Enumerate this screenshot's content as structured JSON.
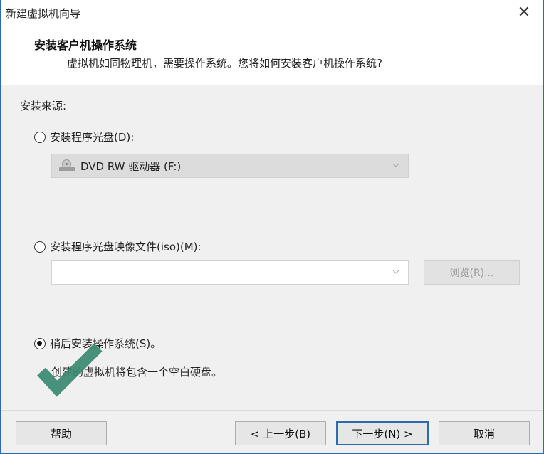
{
  "window": {
    "title": "新建虚拟机向导",
    "close_glyph": "✕"
  },
  "header": {
    "title": "安装客户机操作系统",
    "subtitle": "虚拟机如同物理机，需要操作系统。您将如何安装客户机操作系统?"
  },
  "source_label": "安装来源:",
  "options": {
    "disc": {
      "label": "安装程序光盘(D):",
      "selected": false
    },
    "disc_drive": {
      "value": "DVD RW 驱动器 (F:)",
      "icon": "dvd-drive-icon",
      "enabled": false
    },
    "iso": {
      "label": "安装程序光盘映像文件(iso)(M):",
      "selected": false
    },
    "iso_path": {
      "value": "",
      "placeholder": ""
    },
    "browse_label": "浏览(R)...",
    "later": {
      "label": "稍后安装操作系统(S)。",
      "selected": true
    },
    "later_note": "创建的虚拟机将包含一个空白硬盘。"
  },
  "buttons": {
    "help": "帮助",
    "back": "< 上一步(B)",
    "next": "下一步(N) >",
    "cancel": "取消"
  },
  "colors": {
    "accent_border": "#2b6cb0",
    "checkmark_overlay": "#3a8a72"
  }
}
